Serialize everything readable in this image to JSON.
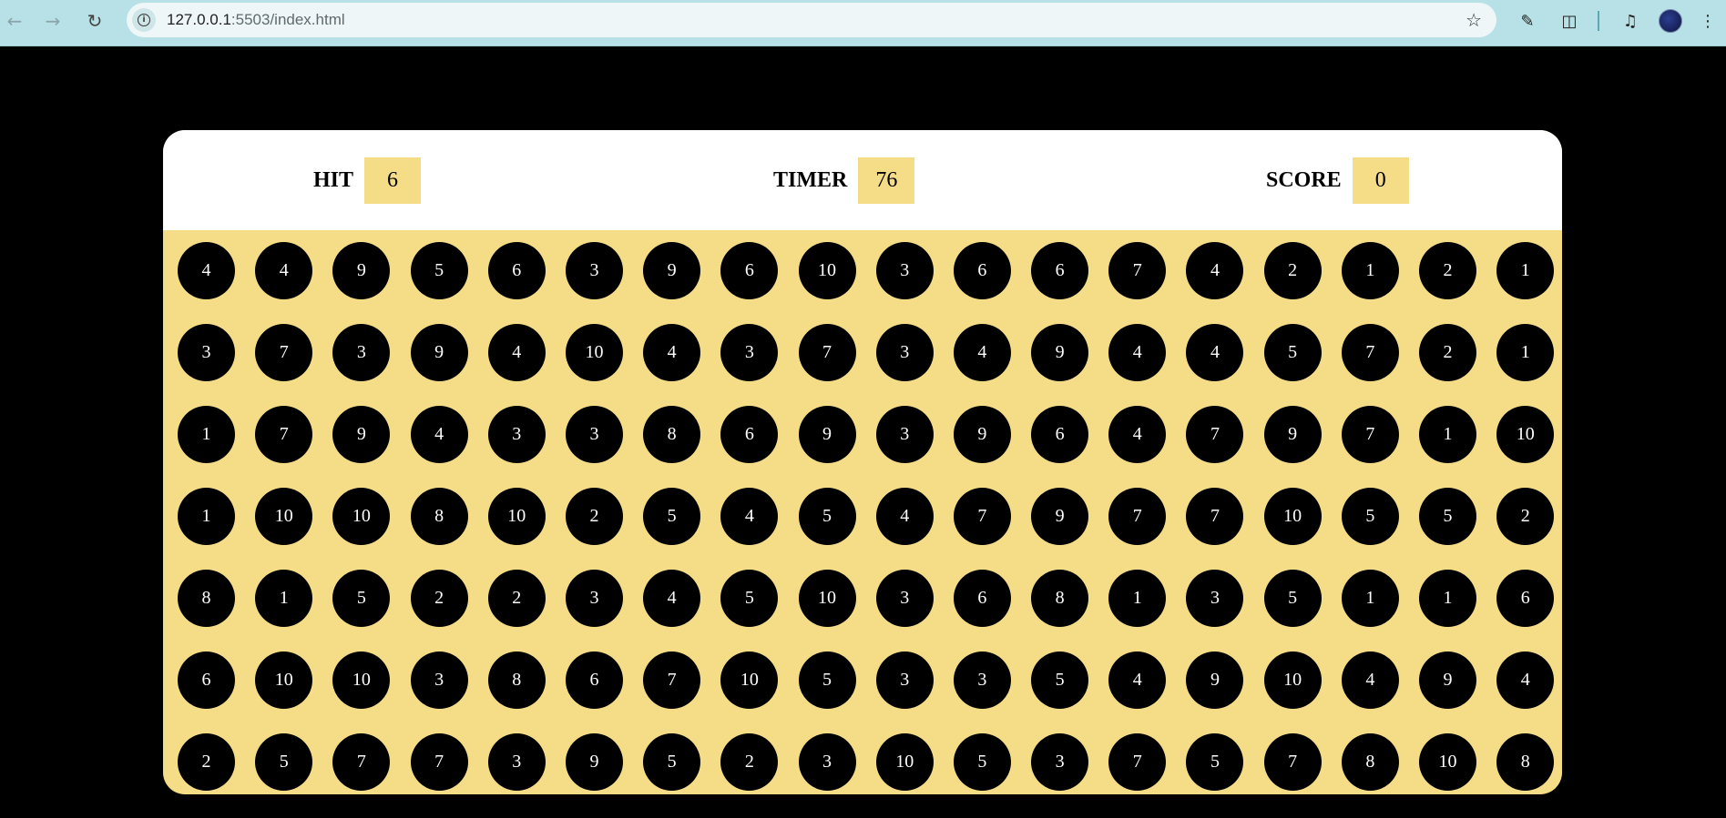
{
  "browser": {
    "url_host": "127.0.0.1",
    "url_path": ":5503/index.html",
    "icons": [
      "back-icon",
      "forward-icon",
      "reload-icon",
      "site-info-icon",
      "star-icon",
      "eyedropper-icon",
      "extensions-icon",
      "media-icon",
      "profile-avatar"
    ]
  },
  "colors": {
    "panel": "#f5dd88",
    "bubble": "#000000",
    "background": "#000000"
  },
  "game": {
    "hit_label": "HIT",
    "hit_value": "6",
    "timer_label": "TIMER",
    "timer_value": "76",
    "score_label": "SCORE",
    "score_value": "0",
    "bubbles": [
      [
        "4",
        "4",
        "9",
        "5",
        "6",
        "3",
        "9",
        "6",
        "10",
        "3",
        "6",
        "6",
        "7",
        "4",
        "2",
        "1",
        "2",
        "1"
      ],
      [
        "3",
        "7",
        "3",
        "9",
        "4",
        "10",
        "4",
        "3",
        "7",
        "3",
        "4",
        "9",
        "4",
        "4",
        "5",
        "7",
        "2",
        "1"
      ],
      [
        "1",
        "7",
        "9",
        "4",
        "3",
        "3",
        "8",
        "6",
        "9",
        "3",
        "9",
        "6",
        "4",
        "7",
        "9",
        "7",
        "1",
        "10"
      ],
      [
        "1",
        "10",
        "10",
        "8",
        "10",
        "2",
        "5",
        "4",
        "5",
        "4",
        "7",
        "9",
        "7",
        "7",
        "10",
        "5",
        "5",
        "2"
      ],
      [
        "8",
        "1",
        "5",
        "2",
        "2",
        "3",
        "4",
        "5",
        "10",
        "3",
        "6",
        "8",
        "1",
        "3",
        "5",
        "1",
        "1",
        "6"
      ],
      [
        "6",
        "10",
        "10",
        "3",
        "8",
        "6",
        "7",
        "10",
        "5",
        "3",
        "3",
        "5",
        "4",
        "9",
        "10",
        "4",
        "9",
        "4"
      ],
      [
        "2",
        "5",
        "7",
        "7",
        "3",
        "9",
        "5",
        "2",
        "3",
        "10",
        "5",
        "3",
        "7",
        "5",
        "7",
        "8",
        "10",
        "8"
      ]
    ]
  }
}
